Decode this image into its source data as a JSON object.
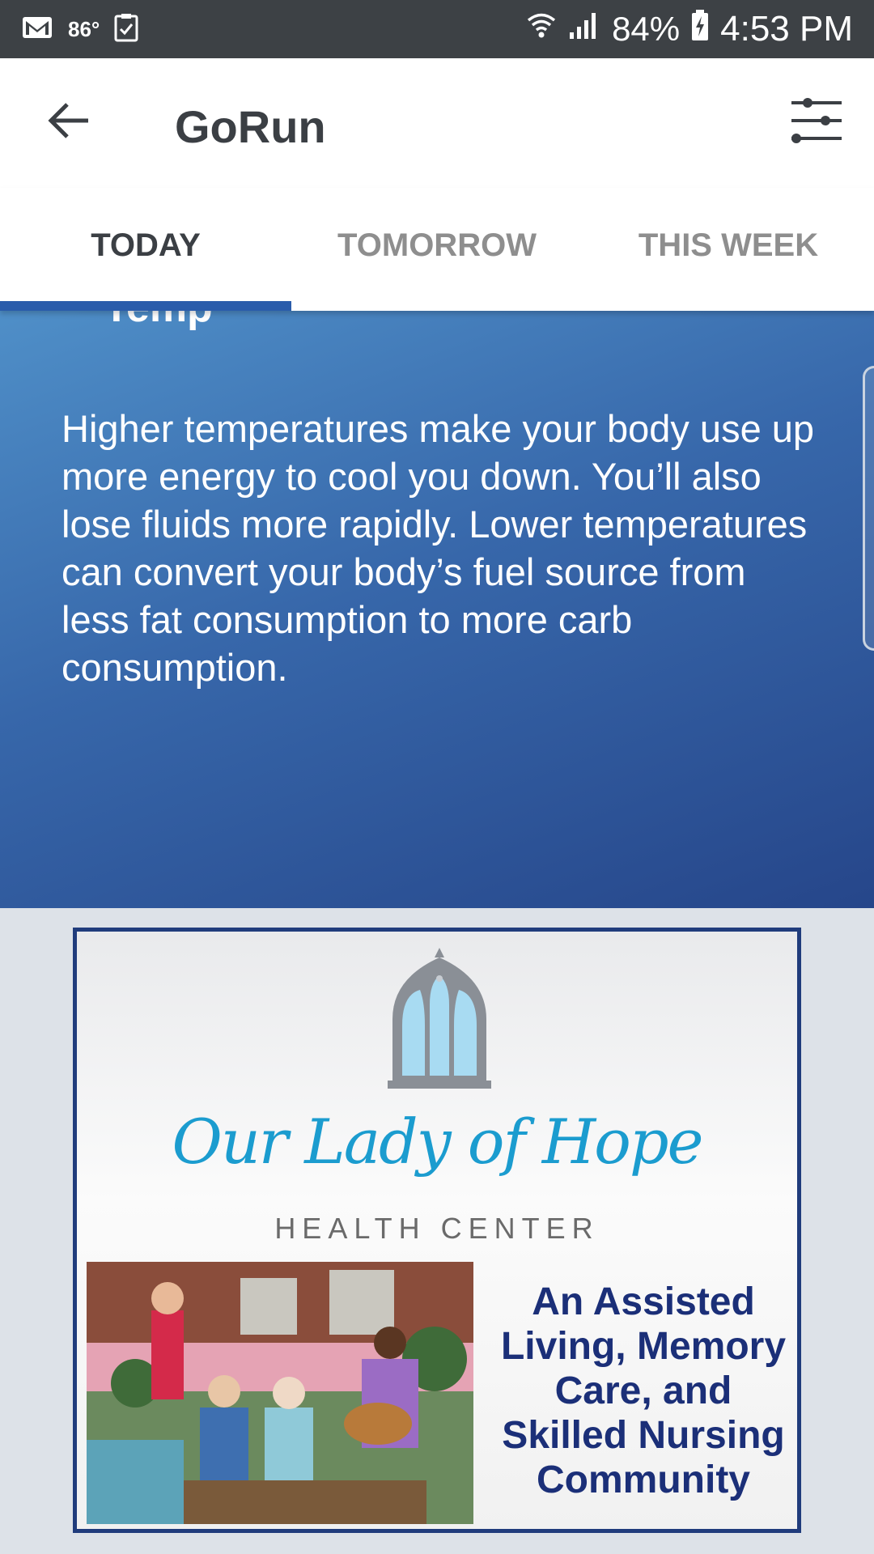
{
  "status_bar": {
    "temperature": "86°",
    "battery": "84%",
    "time": "4:53 PM",
    "icons": [
      "gmail-icon",
      "checklist-icon",
      "wifi-icon",
      "signal-icon",
      "battery-charging-icon"
    ]
  },
  "app_bar": {
    "title": "GoRun",
    "back_icon": "arrow-left-icon",
    "filter_icon": "sliders-icon"
  },
  "tabs": [
    {
      "label": "TODAY",
      "active": true
    },
    {
      "label": "TOMORROW",
      "active": false
    },
    {
      "label": "THIS WEEK",
      "active": false
    }
  ],
  "info_card": {
    "title": "Temp",
    "body": "Higher temperatures make your body use up more energy to cool you down. You’ll also lose fluids more rapidly. Lower temperatures can convert your body’s fuel source from less fat consumption to more carb consumption."
  },
  "ad": {
    "script_title": "Our Lady of Hope",
    "subtitle": "HEALTH CENTER",
    "tagline": "An Assisted Living, Memory Care, and Skilled Nursing Community"
  },
  "colors": {
    "status_bar": "#3d4145",
    "tab_indicator": "#2a5cab",
    "card_gradient_start": "#4f8fc8",
    "card_gradient_end": "#26468a",
    "ad_script": "#1b9ccf",
    "ad_text": "#1b2f78"
  }
}
